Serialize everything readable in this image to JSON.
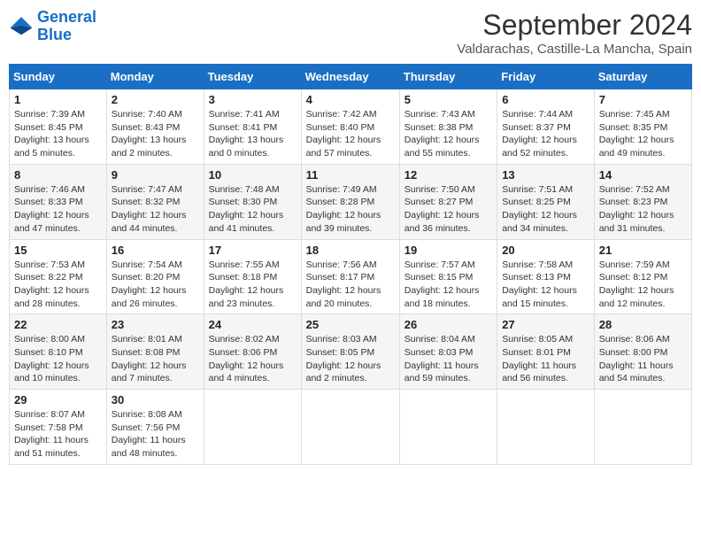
{
  "logo": {
    "line1": "General",
    "line2": "Blue"
  },
  "title": "September 2024",
  "subtitle": "Valdarachas, Castille-La Mancha, Spain",
  "headers": [
    "Sunday",
    "Monday",
    "Tuesday",
    "Wednesday",
    "Thursday",
    "Friday",
    "Saturday"
  ],
  "weeks": [
    [
      {
        "day": "1",
        "info": "Sunrise: 7:39 AM\nSunset: 8:45 PM\nDaylight: 13 hours\nand 5 minutes."
      },
      {
        "day": "2",
        "info": "Sunrise: 7:40 AM\nSunset: 8:43 PM\nDaylight: 13 hours\nand 2 minutes."
      },
      {
        "day": "3",
        "info": "Sunrise: 7:41 AM\nSunset: 8:41 PM\nDaylight: 13 hours\nand 0 minutes."
      },
      {
        "day": "4",
        "info": "Sunrise: 7:42 AM\nSunset: 8:40 PM\nDaylight: 12 hours\nand 57 minutes."
      },
      {
        "day": "5",
        "info": "Sunrise: 7:43 AM\nSunset: 8:38 PM\nDaylight: 12 hours\nand 55 minutes."
      },
      {
        "day": "6",
        "info": "Sunrise: 7:44 AM\nSunset: 8:37 PM\nDaylight: 12 hours\nand 52 minutes."
      },
      {
        "day": "7",
        "info": "Sunrise: 7:45 AM\nSunset: 8:35 PM\nDaylight: 12 hours\nand 49 minutes."
      }
    ],
    [
      {
        "day": "8",
        "info": "Sunrise: 7:46 AM\nSunset: 8:33 PM\nDaylight: 12 hours\nand 47 minutes."
      },
      {
        "day": "9",
        "info": "Sunrise: 7:47 AM\nSunset: 8:32 PM\nDaylight: 12 hours\nand 44 minutes."
      },
      {
        "day": "10",
        "info": "Sunrise: 7:48 AM\nSunset: 8:30 PM\nDaylight: 12 hours\nand 41 minutes."
      },
      {
        "day": "11",
        "info": "Sunrise: 7:49 AM\nSunset: 8:28 PM\nDaylight: 12 hours\nand 39 minutes."
      },
      {
        "day": "12",
        "info": "Sunrise: 7:50 AM\nSunset: 8:27 PM\nDaylight: 12 hours\nand 36 minutes."
      },
      {
        "day": "13",
        "info": "Sunrise: 7:51 AM\nSunset: 8:25 PM\nDaylight: 12 hours\nand 34 minutes."
      },
      {
        "day": "14",
        "info": "Sunrise: 7:52 AM\nSunset: 8:23 PM\nDaylight: 12 hours\nand 31 minutes."
      }
    ],
    [
      {
        "day": "15",
        "info": "Sunrise: 7:53 AM\nSunset: 8:22 PM\nDaylight: 12 hours\nand 28 minutes."
      },
      {
        "day": "16",
        "info": "Sunrise: 7:54 AM\nSunset: 8:20 PM\nDaylight: 12 hours\nand 26 minutes."
      },
      {
        "day": "17",
        "info": "Sunrise: 7:55 AM\nSunset: 8:18 PM\nDaylight: 12 hours\nand 23 minutes."
      },
      {
        "day": "18",
        "info": "Sunrise: 7:56 AM\nSunset: 8:17 PM\nDaylight: 12 hours\nand 20 minutes."
      },
      {
        "day": "19",
        "info": "Sunrise: 7:57 AM\nSunset: 8:15 PM\nDaylight: 12 hours\nand 18 minutes."
      },
      {
        "day": "20",
        "info": "Sunrise: 7:58 AM\nSunset: 8:13 PM\nDaylight: 12 hours\nand 15 minutes."
      },
      {
        "day": "21",
        "info": "Sunrise: 7:59 AM\nSunset: 8:12 PM\nDaylight: 12 hours\nand 12 minutes."
      }
    ],
    [
      {
        "day": "22",
        "info": "Sunrise: 8:00 AM\nSunset: 8:10 PM\nDaylight: 12 hours\nand 10 minutes."
      },
      {
        "day": "23",
        "info": "Sunrise: 8:01 AM\nSunset: 8:08 PM\nDaylight: 12 hours\nand 7 minutes."
      },
      {
        "day": "24",
        "info": "Sunrise: 8:02 AM\nSunset: 8:06 PM\nDaylight: 12 hours\nand 4 minutes."
      },
      {
        "day": "25",
        "info": "Sunrise: 8:03 AM\nSunset: 8:05 PM\nDaylight: 12 hours\nand 2 minutes."
      },
      {
        "day": "26",
        "info": "Sunrise: 8:04 AM\nSunset: 8:03 PM\nDaylight: 11 hours\nand 59 minutes."
      },
      {
        "day": "27",
        "info": "Sunrise: 8:05 AM\nSunset: 8:01 PM\nDaylight: 11 hours\nand 56 minutes."
      },
      {
        "day": "28",
        "info": "Sunrise: 8:06 AM\nSunset: 8:00 PM\nDaylight: 11 hours\nand 54 minutes."
      }
    ],
    [
      {
        "day": "29",
        "info": "Sunrise: 8:07 AM\nSunset: 7:58 PM\nDaylight: 11 hours\nand 51 minutes."
      },
      {
        "day": "30",
        "info": "Sunrise: 8:08 AM\nSunset: 7:56 PM\nDaylight: 11 hours\nand 48 minutes."
      },
      null,
      null,
      null,
      null,
      null
    ]
  ]
}
